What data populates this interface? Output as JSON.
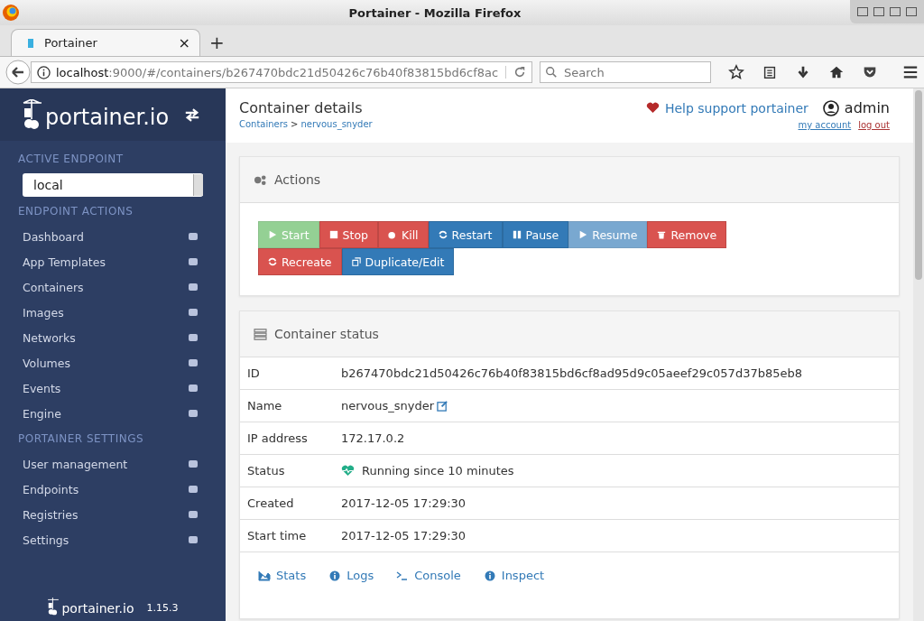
{
  "window": {
    "title": "Portainer - Mozilla Firefox"
  },
  "tabs": [
    {
      "label": "Portainer",
      "selected": true,
      "close": "×"
    }
  ],
  "new_tab": "+",
  "address": {
    "host": "localhost",
    "path": ":9000/#/containers/b267470bdc21d50426c76b40f83815bd6cf8ac"
  },
  "search": {
    "placeholder": "Search"
  },
  "sidebar": {
    "logo": "portainer.io",
    "endpoint_heading": "ACTIVE ENDPOINT",
    "endpoint": "local",
    "sections": [
      {
        "heading": "ENDPOINT ACTIONS",
        "items": [
          "Dashboard",
          "App Templates",
          "Containers",
          "Images",
          "Networks",
          "Volumes",
          "Events",
          "Engine"
        ]
      },
      {
        "heading": "PORTAINER SETTINGS",
        "items": [
          "User management",
          "Endpoints",
          "Registries",
          "Settings"
        ]
      }
    ],
    "footer_logo": "portainer.io",
    "version": "1.15.3"
  },
  "header": {
    "title": "Container details",
    "breadcrumb": [
      "Containers",
      "nervous_snyder"
    ],
    "breadcrumb_sep": ">",
    "help": "Help support portainer",
    "user": "admin",
    "my_account": "my account",
    "log_out": "log out"
  },
  "actions": {
    "title": "Actions",
    "buttons": [
      {
        "label": "Start",
        "kind": "success",
        "disabled": true
      },
      {
        "label": "Stop",
        "kind": "danger",
        "disabled": false
      },
      {
        "label": "Kill",
        "kind": "danger",
        "disabled": false
      },
      {
        "label": "Restart",
        "kind": "primary",
        "disabled": false
      },
      {
        "label": "Pause",
        "kind": "primary",
        "disabled": false
      },
      {
        "label": "Resume",
        "kind": "primary",
        "disabled": true
      },
      {
        "label": "Remove",
        "kind": "danger",
        "disabled": false
      },
      {
        "label": "Recreate",
        "kind": "danger",
        "disabled": false
      },
      {
        "label": "Duplicate/Edit",
        "kind": "primary",
        "disabled": false
      }
    ]
  },
  "status": {
    "title": "Container status",
    "rows": [
      {
        "label": "ID",
        "value": "b267470bdc21d50426c76b40f83815bd6cf8ad95d9c05aeef29c057d37b85eb8",
        "kind": "text"
      },
      {
        "label": "Name",
        "value": "nervous_snyder",
        "kind": "editable"
      },
      {
        "label": "IP address",
        "value": "172.17.0.2",
        "kind": "text"
      },
      {
        "label": "Status",
        "value": "Running since 10 minutes",
        "kind": "health"
      },
      {
        "label": "Created",
        "value": "2017-12-05 17:29:30",
        "kind": "text"
      },
      {
        "label": "Start time",
        "value": "2017-12-05 17:29:30",
        "kind": "text"
      }
    ],
    "links": [
      "Stats",
      "Logs",
      "Console",
      "Inspect"
    ]
  }
}
